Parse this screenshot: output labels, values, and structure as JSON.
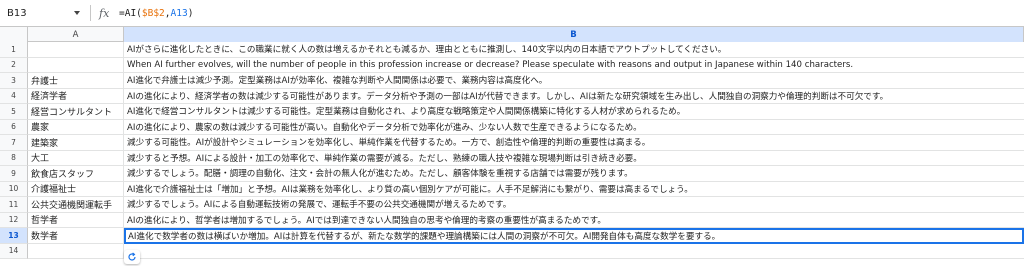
{
  "formula_bar": {
    "name_box": "B13",
    "fx_label": "fx",
    "formula_prefix": "=AI(",
    "formula_ref1": "$B$2",
    "formula_comma": ",",
    "formula_ref2": "A13",
    "formula_suffix": ")"
  },
  "columns": {
    "a": "A",
    "b": "B"
  },
  "rows": [
    {
      "num": "1",
      "a": "",
      "b": "AIがさらに進化したときに、この職業に就く人の数は増えるかそれとも減るか、理由とともに推測し、140文字以内の日本語でアウトプットしてください。"
    },
    {
      "num": "2",
      "a": "",
      "b": "When AI further evolves, will the number of people in this profession increase or decrease? Please speculate with reasons and output in Japanese within 140 characters."
    },
    {
      "num": "3",
      "a": "弁護士",
      "b": "AI進化で弁護士は減少予測。定型業務はAIが効率化、複雑な判断や人間関係は必要で、業務内容は高度化へ。"
    },
    {
      "num": "4",
      "a": "経済学者",
      "b": "AIの進化により、経済学者の数は減少する可能性があります。データ分析や予測の一部はAIが代替できます。しかし、AIは新たな研究領域を生み出し、人間独自の洞察力や倫理的判断は不可欠です。"
    },
    {
      "num": "5",
      "a": "経営コンサルタント",
      "b": "AI進化で経営コンサルタントは減少する可能性。定型業務は自動化され、より高度な戦略策定や人間関係構築に特化する人材が求められるため。"
    },
    {
      "num": "6",
      "a": "農家",
      "b": "AIの進化により、農家の数は減少する可能性が高い。自動化やデータ分析で効率化が進み、少ない人数で生産できるようになるため。"
    },
    {
      "num": "7",
      "a": "建築家",
      "b": "減少する可能性。AIが設計やシミュレーションを効率化し、単純作業を代替するため。一方で、創造性や倫理的判断の重要性は高まる。"
    },
    {
      "num": "8",
      "a": "大工",
      "b": "減少すると予想。AIによる設計・加工の効率化で、単純作業の需要が減る。ただし、熟練の職人技や複雑な現場判断は引き続き必要。"
    },
    {
      "num": "9",
      "a": "飲食店スタッフ",
      "b": "減少するでしょう。配膳・調理の自動化、注文・会計の無人化が進むため。ただし、顧客体験を重視する店舗では需要が残ります。"
    },
    {
      "num": "10",
      "a": "介護福祉士",
      "b": "AI進化で介護福祉士は「増加」と予想。AIは業務を効率化し、より質の高い個別ケアが可能に。人手不足解消にも繋がり、需要は高まるでしょう。"
    },
    {
      "num": "11",
      "a": "公共交通機関運転手",
      "b": "減少するでしょう。AIによる自動運転技術の発展で、運転手不要の公共交通機関が増えるためです。"
    },
    {
      "num": "12",
      "a": "哲学者",
      "b": "AIの進化により、哲学者は増加するでしょう。AIでは到達できない人間独自の思考や倫理的考察の重要性が高まるためです。"
    },
    {
      "num": "13",
      "a": "数学者",
      "b": "AI進化で数学者の数は横ばいか増加。AIは計算を代替するが、新たな数学的課題や理論構築には人間の洞察が不可欠。AI開発自体も高度な数学を要する。"
    },
    {
      "num": "14",
      "a": "",
      "b": ""
    }
  ],
  "colors": {
    "selection": "#1a73e8",
    "header_highlight": "#d3e3fd"
  }
}
